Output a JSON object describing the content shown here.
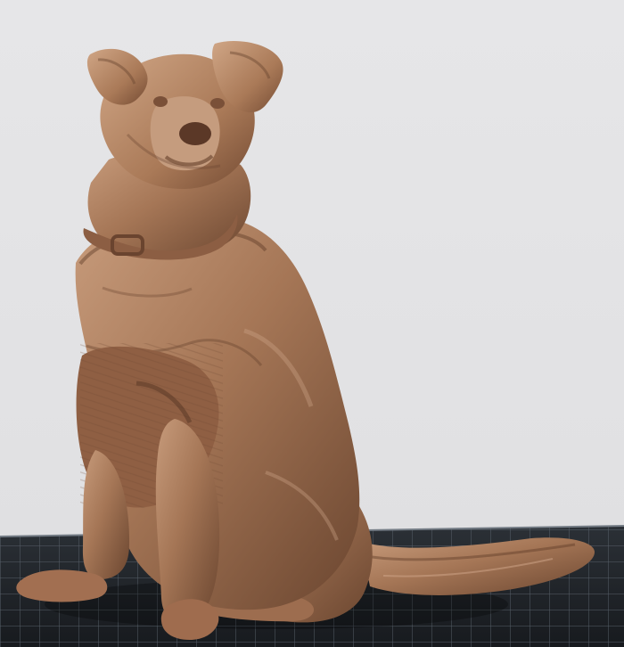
{
  "viewport": {
    "background_color": "#e3e3e5",
    "bed_color": "#1f2328",
    "bed_grid_color": "#5d6670",
    "model_base_color": "#a57656",
    "model_highlight_color": "#c79b7b",
    "model_shadow_color": "#6b4630"
  },
  "model": {
    "subject_icon": "dog-sculpture-icon",
    "view_mode": "3d-preview"
  }
}
